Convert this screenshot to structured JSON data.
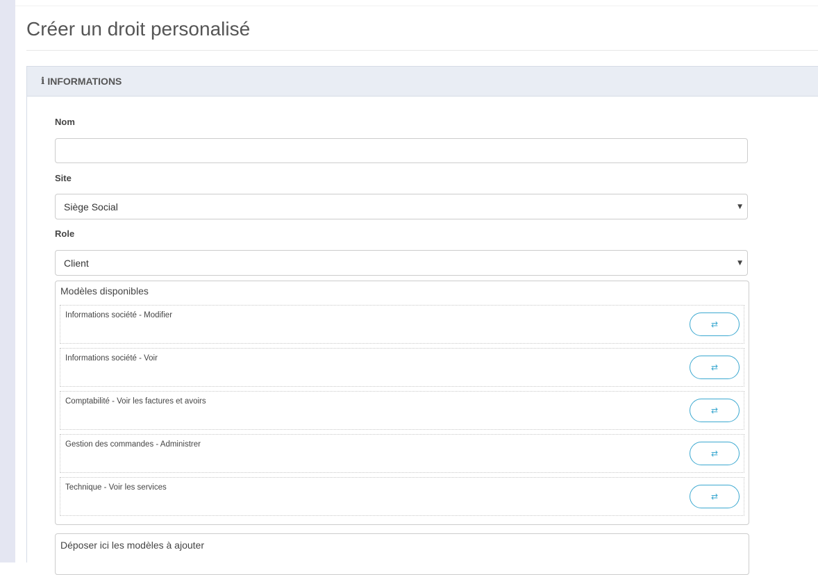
{
  "page": {
    "title": "Créer un droit personalisé"
  },
  "panel": {
    "header_icon": "info-icon",
    "header_title": "INFORMATIONS"
  },
  "form": {
    "nom_label": "Nom",
    "nom_value": "",
    "site_label": "Site",
    "site_selected": "Siège Social",
    "role_label": "Role",
    "role_selected": "Client"
  },
  "models": {
    "title": "Modèles disponibles",
    "items": [
      {
        "label": "Informations société - Modifier"
      },
      {
        "label": "Informations société - Voir"
      },
      {
        "label": "Comptabilité - Voir les factures et avoirs"
      },
      {
        "label": "Gestion des commandes - Administrer"
      },
      {
        "label": "Technique - Voir les services"
      }
    ],
    "action_icon": "swap-icon"
  },
  "drop_zone": {
    "label": "Déposer ici les modèles à ajouter"
  },
  "colors": {
    "accent": "#3ba8d0",
    "panel_header_bg": "#e9edf4",
    "left_rail": "#e4e6f2"
  }
}
